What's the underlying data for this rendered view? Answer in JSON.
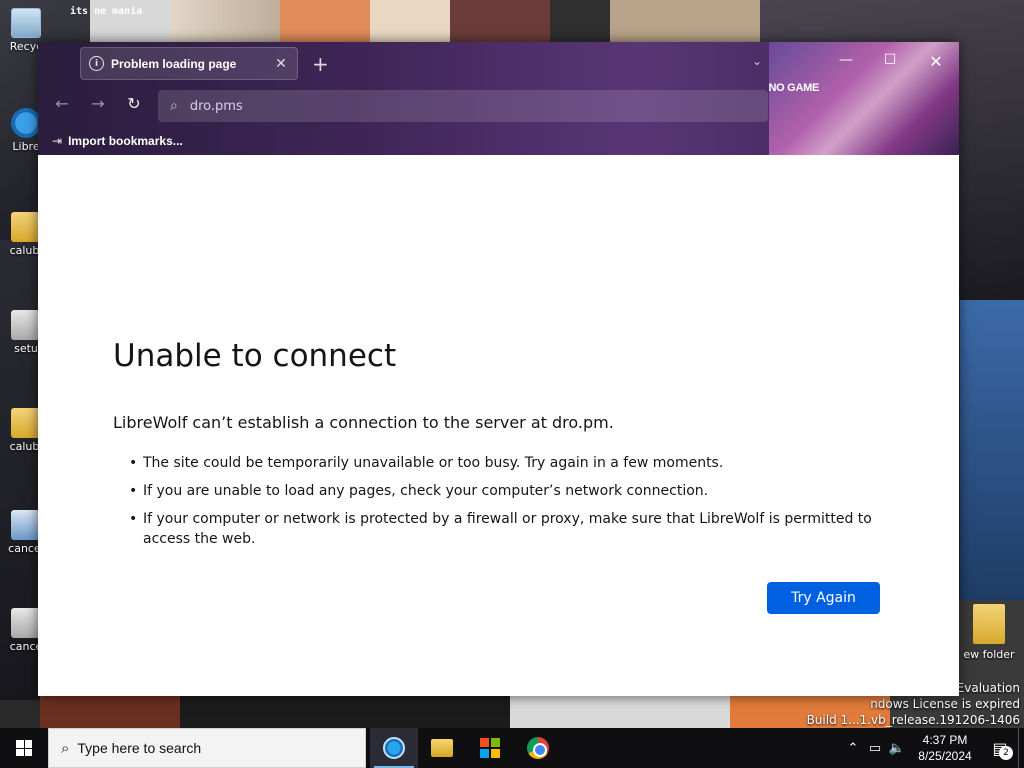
{
  "desktop": {
    "icons": [
      {
        "label": "Recyc",
        "icon": "recycle-bin-icon"
      },
      {
        "label": "Libre",
        "icon": "librewolf-icon"
      },
      {
        "label": "calubj",
        "icon": "folder-icon"
      },
      {
        "label": "setu",
        "icon": "setup-icon"
      },
      {
        "label": "calubj",
        "icon": "folder-icon"
      },
      {
        "label": "cancel",
        "icon": "app-icon"
      },
      {
        "label": "cance",
        "icon": "setup-icon"
      }
    ],
    "right_icon": {
      "label": "ew folder",
      "icon": "folder-icon"
    },
    "watermark": {
      "line1": "Evaluation",
      "line2": "ndows License is expired",
      "line3": "Build 1...1.vb_release.191206-1406"
    },
    "wallpaper_text": "its ne mania"
  },
  "browser": {
    "tab": {
      "title": "Problem loading page",
      "icon": "info-icon"
    },
    "theme_text": "NO GAME",
    "url": "dro.pms",
    "bookmarks": {
      "label": "Import bookmarks..."
    },
    "colors": {
      "accent": "#0061e0",
      "text": "#15141a"
    }
  },
  "error": {
    "title": "Unable to connect",
    "description": "LibreWolf can’t establish a connection to the server at dro.pm.",
    "items": [
      "The site could be temporarily unavailable or too busy. Try again in a few moments.",
      "If you are unable to load any pages, check your computer’s network connection.",
      "If your computer or network is protected by a firewall or proxy, make sure that LibreWolf is permitted to access the web."
    ],
    "button": "Try Again"
  },
  "taskbar": {
    "search_placeholder": "Type here to search",
    "time": "4:37 PM",
    "date": "8/25/2024",
    "notifications": "2"
  }
}
